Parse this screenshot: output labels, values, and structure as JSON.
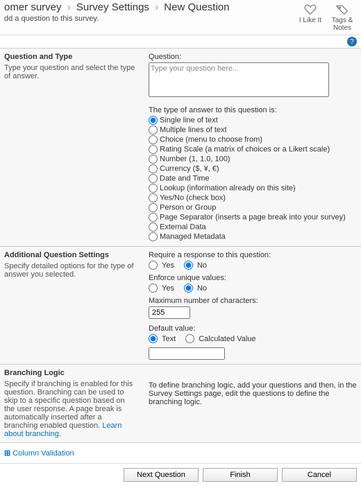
{
  "breadcrumb": {
    "part1": "omer survey",
    "part2": "Survey Settings",
    "leaf": "New Question"
  },
  "subtitle": "dd a question to this survey.",
  "actions": {
    "like": "I Like It",
    "tags": "Tags & Notes"
  },
  "s1": {
    "title": "Question and Type",
    "desc": "Type your question and select the type of answer.",
    "qlabel": "Question:",
    "placeholder": "Type your question here...",
    "typelabel": "The type of answer to this question is:",
    "opts": [
      "Single line of text",
      "Multiple lines of text",
      "Choice (menu to choose from)",
      "Rating Scale (a matrix of choices or a Likert scale)",
      "Number (1, 1.0, 100)",
      "Currency ($, ¥, €)",
      "Date and Time",
      "Lookup (information already on this site)",
      "Yes/No (check box)",
      "Person or Group",
      "Page Separator (inserts a page break into your survey)",
      "External Data",
      "Managed Metadata"
    ]
  },
  "s2": {
    "title": "Additional Question Settings",
    "desc": "Specify detailed options for the type of answer you selected.",
    "reqlabel": "Require a response to this question:",
    "uniqlabel": "Enforce unique values:",
    "yes": "Yes",
    "no": "No",
    "maxlabel": "Maximum number of characters:",
    "maxval": "255",
    "deflabel": "Default value:",
    "deftext": "Text",
    "defcalc": "Calculated Value"
  },
  "s3": {
    "title": "Branching Logic",
    "desc1": "Specify if branching is enabled for this question. Branching can be used to skip to a specific question based on the user response. A page break is automatically inserted after a branching enabled question. ",
    "learn": "Learn about branching.",
    "rtext": "To define branching logic, add your questions and then, in the Survey Settings page, edit the questions to define the branching logic."
  },
  "cv": "Column Validation",
  "buttons": {
    "next": "Next Question",
    "finish": "Finish",
    "cancel": "Cancel"
  }
}
